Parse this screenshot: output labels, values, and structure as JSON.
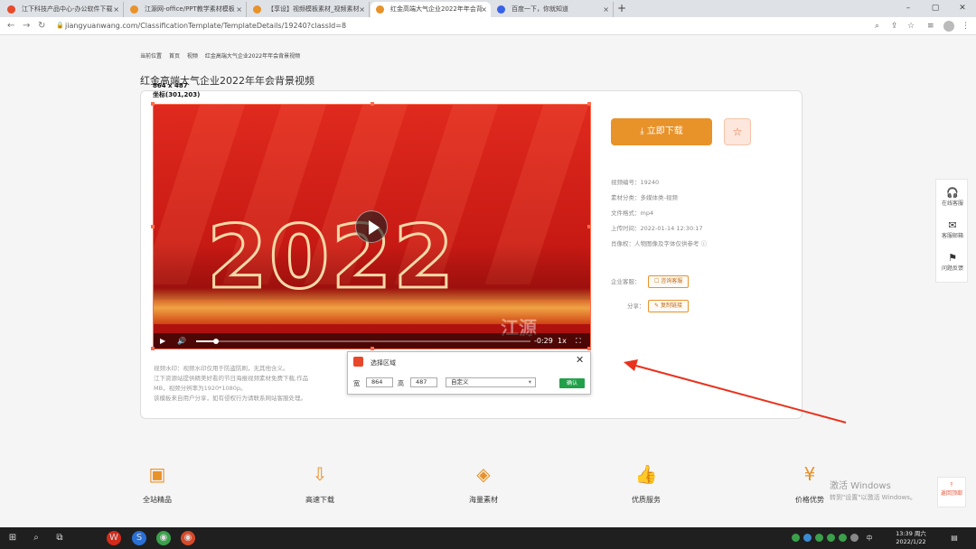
{
  "browser": {
    "tabs": [
      {
        "label": "江下科技产品中心-办公软件下载",
        "favicon_color": "#e84a2a"
      },
      {
        "label": "江源网-office/PPT教学素材模板",
        "favicon_color": "#e8922a"
      },
      {
        "label": "【享设】视频模板素材_视频素材",
        "favicon_color": "#e8922a"
      },
      {
        "label": "红金高端大气企业2022年年会背",
        "favicon_color": "#e8922a"
      },
      {
        "label": "百度一下，你就知道",
        "favicon_color": "#3862e8"
      }
    ],
    "active_tab": 3,
    "url": "jiangyuanwang.com/ClassificationTemplate/TemplateDetails/19240?classId=8"
  },
  "page": {
    "breadcrumb": [
      "当前位置",
      "首页",
      "视频",
      "红金高端大气企业2022年年会背景视频"
    ],
    "title": "红金高端大气企业2022年年会背景视频",
    "video": {
      "big_text": "2022",
      "watermark": "江源",
      "time": "-0:29",
      "speed": "1x",
      "progress": 0.06
    },
    "download_button": "立即下载",
    "info": {
      "video_id": "视频编号：19240",
      "category": "素材分类：多媒体类-视频",
      "format": "文件格式：mp4",
      "upload_time": "上传时间：2022-01-14 12:30:17",
      "copyright": "肖像权：人物图像及字体仅供参考"
    },
    "enterprise_label": "企业客服：",
    "enterprise_btn": "咨询客服",
    "share_label": "分享：",
    "share_btn": "复制链接",
    "description": [
      "视频水印：视频水印仅用于防盗防刷，无其他含义。",
      "江下资源站提供精美好看的节日海报视频素材免费下载,作品",
      "MB，视频分辨率为1920*1080p。",
      "该模板来自用户分享，如有侵权行为请联系网站客服处理。"
    ]
  },
  "selection": {
    "size_text": "864 x 487",
    "coord_text": "坐标(301,203)"
  },
  "dialog": {
    "title": "选择区域",
    "width_label": "宽",
    "width_value": "864",
    "height_label": "高",
    "height_value": "487",
    "preset": "自定义",
    "confirm": "确认"
  },
  "right_toolbar": [
    {
      "label": "在线客服",
      "icon": "headset-icon"
    },
    {
      "label": "客服邮箱",
      "icon": "mail-icon"
    },
    {
      "label": "问题反馈",
      "icon": "feedback-icon"
    }
  ],
  "back_to_top": "返回顶部",
  "features": [
    {
      "label": "全站精品",
      "icon": "quality-icon"
    },
    {
      "label": "高速下载",
      "icon": "download-icon"
    },
    {
      "label": "海量素材",
      "icon": "layers-icon"
    },
    {
      "label": "优质服务",
      "icon": "thumbs-up-icon"
    },
    {
      "label": "价格优势",
      "icon": "price-icon"
    }
  ],
  "activation": {
    "title": "激活 Windows",
    "subtitle": "转到\"设置\"以激活 Windows。"
  },
  "taskbar": {
    "time": "13:39 周六",
    "date": "2022/1/22"
  },
  "colors": {
    "accent": "#e8922a",
    "selection": "#ff6a4c",
    "confirm": "#21a04a",
    "arrow": "#e8321e"
  }
}
